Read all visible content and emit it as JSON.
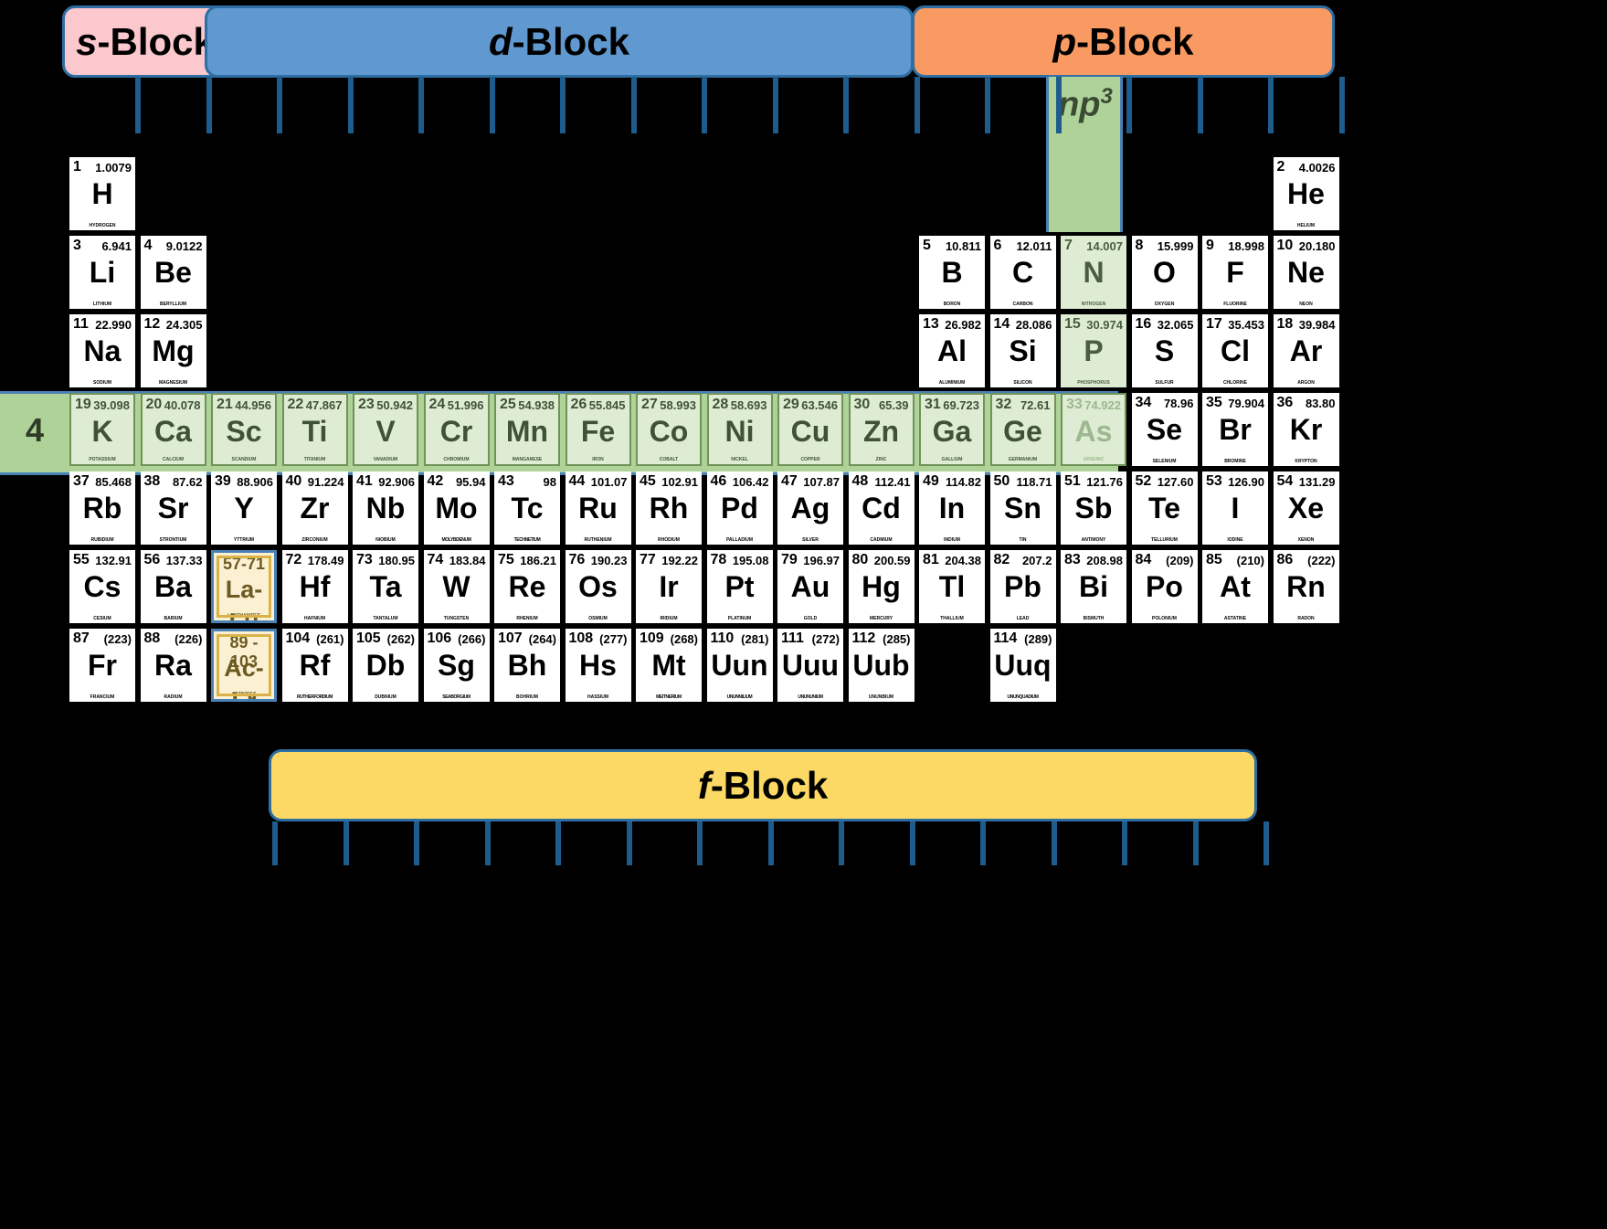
{
  "banners": [
    {
      "id": "s",
      "italic": "s",
      "rest": "-Block",
      "color": "#fbc9cd"
    },
    {
      "id": "d",
      "italic": "d",
      "rest": "-Block",
      "color": "#6098d0"
    },
    {
      "id": "p",
      "italic": "p",
      "rest": "-Block",
      "color": "#fa9a63"
    },
    {
      "id": "f",
      "italic": "f",
      "rest": "-Block",
      "color": "#fcd964"
    }
  ],
  "highlights": {
    "np3_label": "np",
    "np3_exponent": "3",
    "np3_color": "#aed298",
    "period_number": "4",
    "period_color": "#aed298"
  },
  "elements": [
    {
      "num": "1",
      "mass": "1.0079",
      "sym": "H",
      "name": "HYDROGEN",
      "col": 1,
      "row": 1,
      "style": "plain"
    },
    {
      "num": "2",
      "mass": "4.0026",
      "sym": "He",
      "name": "HELIUM",
      "col": 18,
      "row": 1,
      "style": "plain"
    },
    {
      "num": "3",
      "mass": "6.941",
      "sym": "Li",
      "name": "LITHIUM",
      "col": 1,
      "row": 2,
      "style": "plain"
    },
    {
      "num": "4",
      "mass": "9.0122",
      "sym": "Be",
      "name": "BERYLLIUM",
      "col": 2,
      "row": 2,
      "style": "plain"
    },
    {
      "num": "5",
      "mass": "10.811",
      "sym": "B",
      "name": "BORON",
      "col": 13,
      "row": 2,
      "style": "plain"
    },
    {
      "num": "6",
      "mass": "12.011",
      "sym": "C",
      "name": "CARBON",
      "col": 14,
      "row": 2,
      "style": "plain"
    },
    {
      "num": "7",
      "mass": "14.007",
      "sym": "N",
      "name": "NITROGEN",
      "col": 15,
      "row": 2,
      "style": "np3"
    },
    {
      "num": "8",
      "mass": "15.999",
      "sym": "O",
      "name": "OXYGEN",
      "col": 16,
      "row": 2,
      "style": "plain"
    },
    {
      "num": "9",
      "mass": "18.998",
      "sym": "F",
      "name": "FLUORINE",
      "col": 17,
      "row": 2,
      "style": "plain"
    },
    {
      "num": "10",
      "mass": "20.180",
      "sym": "Ne",
      "name": "NEON",
      "col": 18,
      "row": 2,
      "style": "plain"
    },
    {
      "num": "11",
      "mass": "22.990",
      "sym": "Na",
      "name": "SODIUM",
      "col": 1,
      "row": 3,
      "style": "plain"
    },
    {
      "num": "12",
      "mass": "24.305",
      "sym": "Mg",
      "name": "MAGNESIUM",
      "col": 2,
      "row": 3,
      "style": "plain"
    },
    {
      "num": "13",
      "mass": "26.982",
      "sym": "Al",
      "name": "ALUMINIUM",
      "col": 13,
      "row": 3,
      "style": "plain"
    },
    {
      "num": "14",
      "mass": "28.086",
      "sym": "Si",
      "name": "SILICON",
      "col": 14,
      "row": 3,
      "style": "plain"
    },
    {
      "num": "15",
      "mass": "30.974",
      "sym": "P",
      "name": "PHOSPHORUS",
      "col": 15,
      "row": 3,
      "style": "np3"
    },
    {
      "num": "16",
      "mass": "32.065",
      "sym": "S",
      "name": "SULFUR",
      "col": 16,
      "row": 3,
      "style": "plain"
    },
    {
      "num": "17",
      "mass": "35.453",
      "sym": "Cl",
      "name": "CHLORINE",
      "col": 17,
      "row": 3,
      "style": "plain"
    },
    {
      "num": "18",
      "mass": "39.984",
      "sym": "Ar",
      "name": "ARGON",
      "col": 18,
      "row": 3,
      "style": "plain"
    },
    {
      "num": "19",
      "mass": "39.098",
      "sym": "K",
      "name": "POTASSIUM",
      "col": 1,
      "row": 4,
      "style": "green"
    },
    {
      "num": "20",
      "mass": "40.078",
      "sym": "Ca",
      "name": "CALCIUM",
      "col": 2,
      "row": 4,
      "style": "green"
    },
    {
      "num": "21",
      "mass": "44.956",
      "sym": "Sc",
      "name": "SCANDIUM",
      "col": 3,
      "row": 4,
      "style": "green"
    },
    {
      "num": "22",
      "mass": "47.867",
      "sym": "Ti",
      "name": "TITANIUM",
      "col": 4,
      "row": 4,
      "style": "green"
    },
    {
      "num": "23",
      "mass": "50.942",
      "sym": "V",
      "name": "VANADIUM",
      "col": 5,
      "row": 4,
      "style": "green"
    },
    {
      "num": "24",
      "mass": "51.996",
      "sym": "Cr",
      "name": "CHROMIUM",
      "col": 6,
      "row": 4,
      "style": "green"
    },
    {
      "num": "25",
      "mass": "54.938",
      "sym": "Mn",
      "name": "MANGANESE",
      "col": 7,
      "row": 4,
      "style": "green"
    },
    {
      "num": "26",
      "mass": "55.845",
      "sym": "Fe",
      "name": "IRON",
      "col": 8,
      "row": 4,
      "style": "green"
    },
    {
      "num": "27",
      "mass": "58.993",
      "sym": "Co",
      "name": "COBALT",
      "col": 9,
      "row": 4,
      "style": "green"
    },
    {
      "num": "28",
      "mass": "58.693",
      "sym": "Ni",
      "name": "NICKEL",
      "col": 10,
      "row": 4,
      "style": "green"
    },
    {
      "num": "29",
      "mass": "63.546",
      "sym": "Cu",
      "name": "COPPER",
      "col": 11,
      "row": 4,
      "style": "green"
    },
    {
      "num": "30",
      "mass": "65.39",
      "sym": "Zn",
      "name": "ZINC",
      "col": 12,
      "row": 4,
      "style": "green"
    },
    {
      "num": "31",
      "mass": "69.723",
      "sym": "Ga",
      "name": "GALLIUM",
      "col": 13,
      "row": 4,
      "style": "green"
    },
    {
      "num": "32",
      "mass": "72.61",
      "sym": "Ge",
      "name": "GERMANIUM",
      "col": 14,
      "row": 4,
      "style": "green"
    },
    {
      "num": "33",
      "mass": "74.922",
      "sym": "As",
      "name": "ARSENIC",
      "col": 15,
      "row": 4,
      "style": "green dim"
    },
    {
      "num": "34",
      "mass": "78.96",
      "sym": "Se",
      "name": "SELENIUM",
      "col": 16,
      "row": 4,
      "style": "plain"
    },
    {
      "num": "35",
      "mass": "79.904",
      "sym": "Br",
      "name": "BROMINE",
      "col": 17,
      "row": 4,
      "style": "plain"
    },
    {
      "num": "36",
      "mass": "83.80",
      "sym": "Kr",
      "name": "KRYPTON",
      "col": 18,
      "row": 4,
      "style": "plain"
    },
    {
      "num": "37",
      "mass": "85.468",
      "sym": "Rb",
      "name": "RUBIDIUM",
      "col": 1,
      "row": 5,
      "style": "plain"
    },
    {
      "num": "38",
      "mass": "87.62",
      "sym": "Sr",
      "name": "STRONTIUM",
      "col": 2,
      "row": 5,
      "style": "plain"
    },
    {
      "num": "39",
      "mass": "88.906",
      "sym": "Y",
      "name": "YTTRIUM",
      "col": 3,
      "row": 5,
      "style": "plain"
    },
    {
      "num": "40",
      "mass": "91.224",
      "sym": "Zr",
      "name": "ZIRCONIUM",
      "col": 4,
      "row": 5,
      "style": "plain"
    },
    {
      "num": "41",
      "mass": "92.906",
      "sym": "Nb",
      "name": "NIOBIUM",
      "col": 5,
      "row": 5,
      "style": "plain"
    },
    {
      "num": "42",
      "mass": "95.94",
      "sym": "Mo",
      "name": "MOLYBDENUM",
      "col": 6,
      "row": 5,
      "style": "plain long"
    },
    {
      "num": "43",
      "mass": "98",
      "sym": "Tc",
      "name": "TECHNETIUM",
      "col": 7,
      "row": 5,
      "style": "plain long"
    },
    {
      "num": "44",
      "mass": "101.07",
      "sym": "Ru",
      "name": "RUTHENIUM",
      "col": 8,
      "row": 5,
      "style": "plain"
    },
    {
      "num": "45",
      "mass": "102.91",
      "sym": "Rh",
      "name": "RHODIUM",
      "col": 9,
      "row": 5,
      "style": "plain"
    },
    {
      "num": "46",
      "mass": "106.42",
      "sym": "Pd",
      "name": "PALLADIUM",
      "col": 10,
      "row": 5,
      "style": "plain"
    },
    {
      "num": "47",
      "mass": "107.87",
      "sym": "Ag",
      "name": "SILVER",
      "col": 11,
      "row": 5,
      "style": "plain"
    },
    {
      "num": "48",
      "mass": "112.41",
      "sym": "Cd",
      "name": "CADMIUM",
      "col": 12,
      "row": 5,
      "style": "plain"
    },
    {
      "num": "49",
      "mass": "114.82",
      "sym": "In",
      "name": "INDIUM",
      "col": 13,
      "row": 5,
      "style": "plain"
    },
    {
      "num": "50",
      "mass": "118.71",
      "sym": "Sn",
      "name": "TIN",
      "col": 14,
      "row": 5,
      "style": "plain"
    },
    {
      "num": "51",
      "mass": "121.76",
      "sym": "Sb",
      "name": "ANTIMONY",
      "col": 15,
      "row": 5,
      "style": "plain"
    },
    {
      "num": "52",
      "mass": "127.60",
      "sym": "Te",
      "name": "TELLURIUM",
      "col": 16,
      "row": 5,
      "style": "plain"
    },
    {
      "num": "53",
      "mass": "126.90",
      "sym": "I",
      "name": "IODINE",
      "col": 17,
      "row": 5,
      "style": "plain"
    },
    {
      "num": "54",
      "mass": "131.29",
      "sym": "Xe",
      "name": "XENON",
      "col": 18,
      "row": 5,
      "style": "plain"
    },
    {
      "num": "55",
      "mass": "132.91",
      "sym": "Cs",
      "name": "CESIUM",
      "col": 1,
      "row": 6,
      "style": "plain"
    },
    {
      "num": "56",
      "mass": "137.33",
      "sym": "Ba",
      "name": "BARIUM",
      "col": 2,
      "row": 6,
      "style": "plain"
    },
    {
      "num": "57-71",
      "mass": "",
      "sym": "La-Lu",
      "name": "LANTHANIDES",
      "col": 3,
      "row": 6,
      "style": "series"
    },
    {
      "num": "72",
      "mass": "178.49",
      "sym": "Hf",
      "name": "HAFNIUM",
      "col": 4,
      "row": 6,
      "style": "plain"
    },
    {
      "num": "73",
      "mass": "180.95",
      "sym": "Ta",
      "name": "TANTALUM",
      "col": 5,
      "row": 6,
      "style": "plain"
    },
    {
      "num": "74",
      "mass": "183.84",
      "sym": "W",
      "name": "TUNGSTEN",
      "col": 6,
      "row": 6,
      "style": "plain"
    },
    {
      "num": "75",
      "mass": "186.21",
      "sym": "Re",
      "name": "RHENIUM",
      "col": 7,
      "row": 6,
      "style": "plain"
    },
    {
      "num": "76",
      "mass": "190.23",
      "sym": "Os",
      "name": "OSMIUM",
      "col": 8,
      "row": 6,
      "style": "plain"
    },
    {
      "num": "77",
      "mass": "192.22",
      "sym": "Ir",
      "name": "IRIDIUM",
      "col": 9,
      "row": 6,
      "style": "plain"
    },
    {
      "num": "78",
      "mass": "195.08",
      "sym": "Pt",
      "name": "PLATINUM",
      "col": 10,
      "row": 6,
      "style": "plain"
    },
    {
      "num": "79",
      "mass": "196.97",
      "sym": "Au",
      "name": "GOLD",
      "col": 11,
      "row": 6,
      "style": "plain"
    },
    {
      "num": "80",
      "mass": "200.59",
      "sym": "Hg",
      "name": "MERCURY",
      "col": 12,
      "row": 6,
      "style": "plain"
    },
    {
      "num": "81",
      "mass": "204.38",
      "sym": "Tl",
      "name": "THALLIUM",
      "col": 13,
      "row": 6,
      "style": "plain"
    },
    {
      "num": "82",
      "mass": "207.2",
      "sym": "Pb",
      "name": "LEAD",
      "col": 14,
      "row": 6,
      "style": "plain"
    },
    {
      "num": "83",
      "mass": "208.98",
      "sym": "Bi",
      "name": "BISMUTH",
      "col": 15,
      "row": 6,
      "style": "plain"
    },
    {
      "num": "84",
      "mass": "(209)",
      "sym": "Po",
      "name": "POLONIUM",
      "col": 16,
      "row": 6,
      "style": "plain"
    },
    {
      "num": "85",
      "mass": "(210)",
      "sym": "At",
      "name": "ASTATINE",
      "col": 17,
      "row": 6,
      "style": "plain"
    },
    {
      "num": "86",
      "mass": "(222)",
      "sym": "Rn",
      "name": "RADON",
      "col": 18,
      "row": 6,
      "style": "plain"
    },
    {
      "num": "87",
      "mass": "(223)",
      "sym": "Fr",
      "name": "FRANCIUM",
      "col": 1,
      "row": 7,
      "style": "plain"
    },
    {
      "num": "88",
      "mass": "(226)",
      "sym": "Ra",
      "name": "RADIUM",
      "col": 2,
      "row": 7,
      "style": "plain"
    },
    {
      "num": "89 - 103",
      "mass": "",
      "sym": "Ac-Lr",
      "name": "ACTINIDES",
      "col": 3,
      "row": 7,
      "style": "series"
    },
    {
      "num": "104",
      "mass": "(261)",
      "sym": "Rf",
      "name": "RUTHERFORDIUM",
      "col": 4,
      "row": 7,
      "style": "plain long"
    },
    {
      "num": "105",
      "mass": "(262)",
      "sym": "Db",
      "name": "DUBNIUM",
      "col": 5,
      "row": 7,
      "style": "plain"
    },
    {
      "num": "106",
      "mass": "(266)",
      "sym": "Sg",
      "name": "SEABORGIUM",
      "col": 6,
      "row": 7,
      "style": "plain long"
    },
    {
      "num": "107",
      "mass": "(264)",
      "sym": "Bh",
      "name": "BOHRIUM",
      "col": 7,
      "row": 7,
      "style": "plain"
    },
    {
      "num": "108",
      "mass": "(277)",
      "sym": "Hs",
      "name": "HASSIUM",
      "col": 8,
      "row": 7,
      "style": "plain"
    },
    {
      "num": "109",
      "mass": "(268)",
      "sym": "Mt",
      "name": "MEITNERIUM",
      "col": 9,
      "row": 7,
      "style": "plain long"
    },
    {
      "num": "110",
      "mass": "(281)",
      "sym": "Uun",
      "name": "UNUNNILIUM",
      "col": 10,
      "row": 7,
      "style": "plain long"
    },
    {
      "num": "111",
      "mass": "(272)",
      "sym": "Uuu",
      "name": "UNUNUNIUM",
      "col": 11,
      "row": 7,
      "style": "plain long"
    },
    {
      "num": "112",
      "mass": "(285)",
      "sym": "Uub",
      "name": "UNUNBIUM",
      "col": 12,
      "row": 7,
      "style": "plain"
    },
    {
      "num": "114",
      "mass": "(289)",
      "sym": "Uuq",
      "name": "UNUNQUADIUM",
      "col": 14,
      "row": 7,
      "style": "plain long"
    }
  ]
}
